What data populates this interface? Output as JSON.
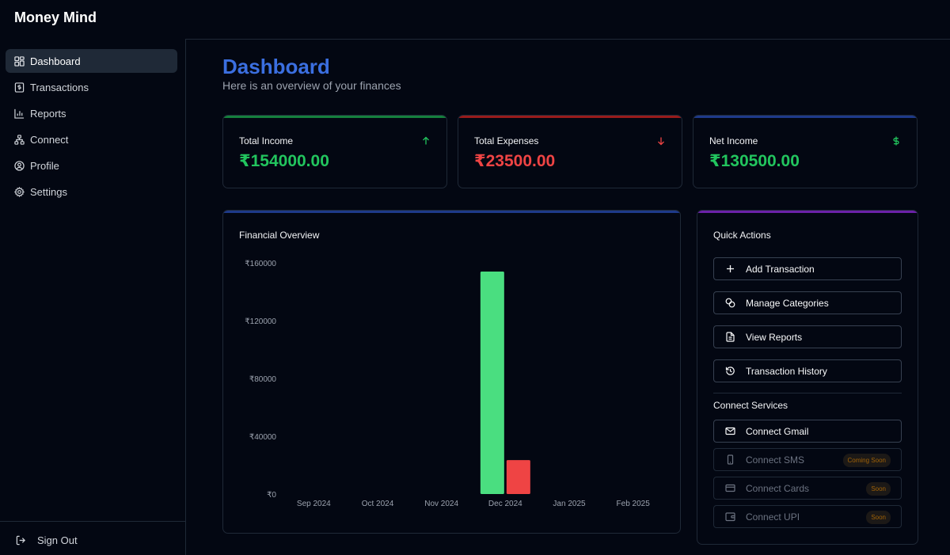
{
  "app": {
    "brand": "Money Mind"
  },
  "sidebar": {
    "items": [
      {
        "label": "Dashboard",
        "icon": "dashboard-icon",
        "active": true
      },
      {
        "label": "Transactions",
        "icon": "receipt-icon",
        "active": false
      },
      {
        "label": "Reports",
        "icon": "bar-chart-icon",
        "active": false
      },
      {
        "label": "Connect",
        "icon": "network-icon",
        "active": false
      },
      {
        "label": "Profile",
        "icon": "user-circle-icon",
        "active": false
      },
      {
        "label": "Settings",
        "icon": "gear-icon",
        "active": false
      }
    ],
    "signout_label": "Sign Out"
  },
  "header": {
    "title": "Dashboard",
    "subtitle": "Here is an overview of your finances"
  },
  "stats": [
    {
      "label": "Total Income",
      "value": "₹154000.00",
      "icon": "arrow-up-icon",
      "color": "#22c55e",
      "accent": "#15803d"
    },
    {
      "label": "Total Expenses",
      "value": "₹23500.00",
      "icon": "arrow-down-icon",
      "color": "#ef4444",
      "accent": "#991b1b"
    },
    {
      "label": "Net Income",
      "value": "₹130500.00",
      "icon": "dollar-icon",
      "color": "#22c55e",
      "accent": "#1e3a8a"
    }
  ],
  "overview": {
    "title": "Financial Overview",
    "accent": "#1e3a8a"
  },
  "chart_data": {
    "type": "bar",
    "title": "Financial Overview",
    "categories": [
      "Sep 2024",
      "Oct 2024",
      "Nov 2024",
      "Dec 2024",
      "Jan 2025",
      "Feb 2025"
    ],
    "series": [
      {
        "values": [
          0,
          0,
          0,
          154000,
          0,
          0
        ],
        "color": "#4ade80"
      },
      {
        "values": [
          0,
          0,
          0,
          23500,
          0,
          0
        ],
        "color": "#ef4444"
      }
    ],
    "yticks": [
      "₹0",
      "₹40000",
      "₹80000",
      "₹120000",
      "₹160000"
    ],
    "ylim": [
      0,
      160000
    ],
    "grid": false,
    "legend": "none"
  },
  "quick_actions": {
    "title": "Quick Actions",
    "accent": "#6b21a8",
    "actions": [
      {
        "label": "Add Transaction",
        "icon": "plus-icon"
      },
      {
        "label": "Manage Categories",
        "icon": "tags-icon"
      },
      {
        "label": "View Reports",
        "icon": "document-icon"
      },
      {
        "label": "Transaction History",
        "icon": "history-icon"
      }
    ],
    "connect_title": "Connect Services",
    "services": [
      {
        "label": "Connect Gmail",
        "icon": "mail-icon",
        "enabled": true,
        "badge": ""
      },
      {
        "label": "Connect SMS",
        "icon": "phone-icon",
        "enabled": false,
        "badge": "Coming Soon"
      },
      {
        "label": "Connect Cards",
        "icon": "credit-card-icon",
        "enabled": false,
        "badge": "Soon"
      },
      {
        "label": "Connect UPI",
        "icon": "wallet-icon",
        "enabled": false,
        "badge": "Soon"
      }
    ]
  }
}
